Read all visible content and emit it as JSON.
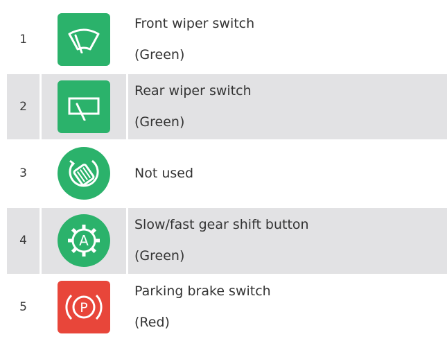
{
  "colors": {
    "green": "#2bb26b",
    "red": "#e8463a",
    "row_shade": "#e2e2e4"
  },
  "rows": [
    {
      "number": "1",
      "icon": "front-wiper-icon",
      "line1": "Front wiper switch",
      "line2": "(Green)"
    },
    {
      "number": "2",
      "icon": "rear-wiper-icon",
      "line1": "Rear wiper switch",
      "line2": "(Green)"
    },
    {
      "number": "3",
      "icon": "rotary-knob-icon",
      "line1": "Not used",
      "line2": ""
    },
    {
      "number": "4",
      "icon": "gear-shift-auto-icon",
      "line1": "Slow/fast gear shift button",
      "line2": "(Green)"
    },
    {
      "number": "5",
      "icon": "parking-brake-icon",
      "line1": "Parking brake switch",
      "line2": "(Red)"
    }
  ]
}
